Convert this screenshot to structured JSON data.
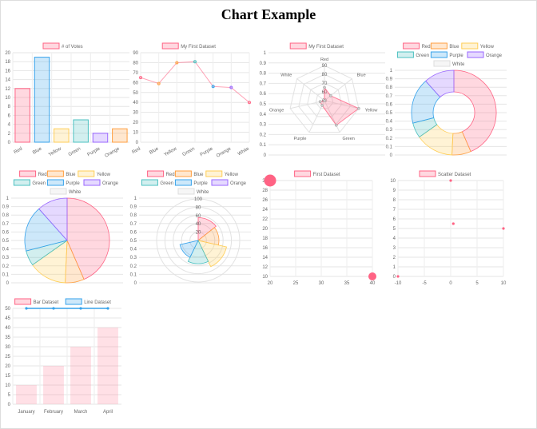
{
  "page": {
    "title": "Chart Example"
  },
  "chart_data": [
    {
      "id": "bar1",
      "type": "bar",
      "categories": [
        "Red",
        "Blue",
        "Yellow",
        "Green",
        "Purple",
        "Orange"
      ],
      "series": [
        {
          "name": "# of Votes",
          "values": [
            12,
            19,
            3,
            5,
            2,
            3
          ]
        }
      ],
      "ylim": [
        0,
        20
      ],
      "yticks": [
        0,
        2,
        4,
        6,
        8,
        10,
        12,
        14,
        16,
        18,
        20
      ],
      "colors": [
        "#ff6384",
        "#36a2eb",
        "#ffce56",
        "#4bc0c0",
        "#9966ff",
        "#ff9f40"
      ],
      "legend": "top",
      "grid": true
    },
    {
      "id": "line1",
      "type": "line",
      "categories": [
        "Red",
        "Blue",
        "Yellow",
        "Green",
        "Purple",
        "Orange",
        "White"
      ],
      "series": [
        {
          "name": "My First Dataset",
          "values": [
            65,
            59,
            80,
            81,
            56,
            55,
            40
          ]
        }
      ],
      "ylim": [
        0,
        90
      ],
      "yticks": [
        0,
        10,
        20,
        30,
        40,
        50,
        60,
        70,
        80,
        90
      ],
      "colors": [
        "#ff6384",
        "#ff9f40",
        "#ff9f40",
        "#4bc0c0",
        "#36a2eb",
        "#9966ff",
        "#ff6384"
      ],
      "legend": "top",
      "grid": true
    },
    {
      "id": "radar1",
      "type": "radar",
      "labels": [
        "Red",
        "Blue",
        "Yellow",
        "Green",
        "Purple",
        "Orange",
        "White"
      ],
      "series": [
        {
          "name": "My First Dataset",
          "values": [
            65,
            59,
            90,
            81,
            56,
            55,
            40
          ]
        }
      ],
      "rlim": [
        50,
        90
      ],
      "rticks": [
        50,
        60,
        70,
        80,
        90
      ],
      "ylim": [
        0,
        1
      ],
      "yticks": [
        0,
        0.1,
        0.2,
        0.3,
        0.4,
        0.5,
        0.6,
        0.7,
        0.8,
        0.9,
        1
      ],
      "legend": "top",
      "grid": true
    },
    {
      "id": "doughnut1",
      "type": "pie",
      "labels": [
        "Red",
        "Blue",
        "Yellow",
        "Green",
        "Purple",
        "Orange",
        "White"
      ],
      "values": [
        300,
        50,
        100,
        40,
        120,
        80,
        0
      ],
      "ylim": [
        0,
        1
      ],
      "yticks": [
        0,
        0.1,
        0.2,
        0.3,
        0.4,
        0.5,
        0.6,
        0.7,
        0.8,
        0.9,
        1
      ],
      "colors": [
        "#ff6384",
        "#ff9f40",
        "#ffce56",
        "#4bc0c0",
        "#36a2eb",
        "#9966ff",
        "#ffffff"
      ],
      "legend": "top",
      "grid": true
    },
    {
      "id": "pie1",
      "type": "pie",
      "labels": [
        "Red",
        "Blue",
        "Yellow",
        "Green",
        "Purple",
        "Orange",
        "White"
      ],
      "values": [
        300,
        50,
        100,
        40,
        120,
        80,
        0
      ],
      "ylim": [
        0,
        1
      ],
      "yticks": [
        0,
        0.1,
        0.2,
        0.3,
        0.4,
        0.5,
        0.6,
        0.7,
        0.8,
        0.9,
        1
      ],
      "colors": [
        "#ff6384",
        "#ff9f40",
        "#ffce56",
        "#4bc0c0",
        "#36a2eb",
        "#9966ff",
        "#ffffff"
      ],
      "legend": "top",
      "grid": true
    },
    {
      "id": "polar1",
      "type": "pie",
      "labels": [
        "Red",
        "Blue",
        "Yellow",
        "Green",
        "Purple",
        "Orange",
        "White"
      ],
      "values": [
        55,
        50,
        70,
        56,
        45,
        0,
        0
      ],
      "rlim": [
        0,
        100
      ],
      "rticks": [
        20,
        40,
        60,
        80,
        100
      ],
      "ylim": [
        0,
        1
      ],
      "yticks": [
        0,
        0.1,
        0.2,
        0.3,
        0.4,
        0.5,
        0.6,
        0.7,
        0.8,
        0.9,
        1
      ],
      "colors": [
        "#ff6384",
        "#ff9f40",
        "#ffce56",
        "#4bc0c0",
        "#36a2eb",
        "#9966ff",
        "#ffffff"
      ],
      "legend": "top",
      "grid": true
    },
    {
      "id": "bubble1",
      "type": "scatter",
      "series": [
        {
          "name": "First Dataset",
          "points": [
            [
              20,
              30,
              15
            ],
            [
              40,
              10,
              10
            ]
          ]
        }
      ],
      "xlim": [
        20,
        40
      ],
      "xticks": [
        20,
        25,
        30,
        35,
        40
      ],
      "ylim": [
        10,
        30
      ],
      "yticks": [
        10,
        12,
        14,
        16,
        18,
        20,
        22,
        24,
        26,
        28,
        30
      ],
      "colors": [
        "#ff6384"
      ],
      "legend": "top",
      "grid": true
    },
    {
      "id": "scatter1",
      "type": "scatter",
      "series": [
        {
          "name": "Scatter Dataset",
          "points": [
            [
              -10,
              0
            ],
            [
              0,
              10
            ],
            [
              10,
              5
            ],
            [
              0.5,
              5.5
            ]
          ]
        }
      ],
      "xlim": [
        -10,
        10
      ],
      "xticks": [
        -10,
        -5,
        0,
        5,
        10
      ],
      "ylim": [
        0,
        10
      ],
      "yticks": [
        0,
        1,
        2,
        3,
        4,
        5,
        6,
        7,
        8,
        9,
        10
      ],
      "colors": [
        "#ff6384"
      ],
      "legend": "top",
      "grid": true
    },
    {
      "id": "mixed1",
      "type": "bar",
      "categories": [
        "January",
        "February",
        "March",
        "April"
      ],
      "series": [
        {
          "name": "Bar Dataset",
          "values": [
            10,
            20,
            30,
            40
          ]
        },
        {
          "name": "Line Dataset",
          "values": [
            50,
            50,
            50,
            50
          ]
        }
      ],
      "ylim": [
        0,
        50
      ],
      "yticks": [
        0,
        5,
        10,
        15,
        20,
        25,
        30,
        35,
        40,
        45,
        50
      ],
      "colors": [
        "#ff6384",
        "#36a2eb"
      ],
      "legend": "top",
      "grid": true
    }
  ]
}
